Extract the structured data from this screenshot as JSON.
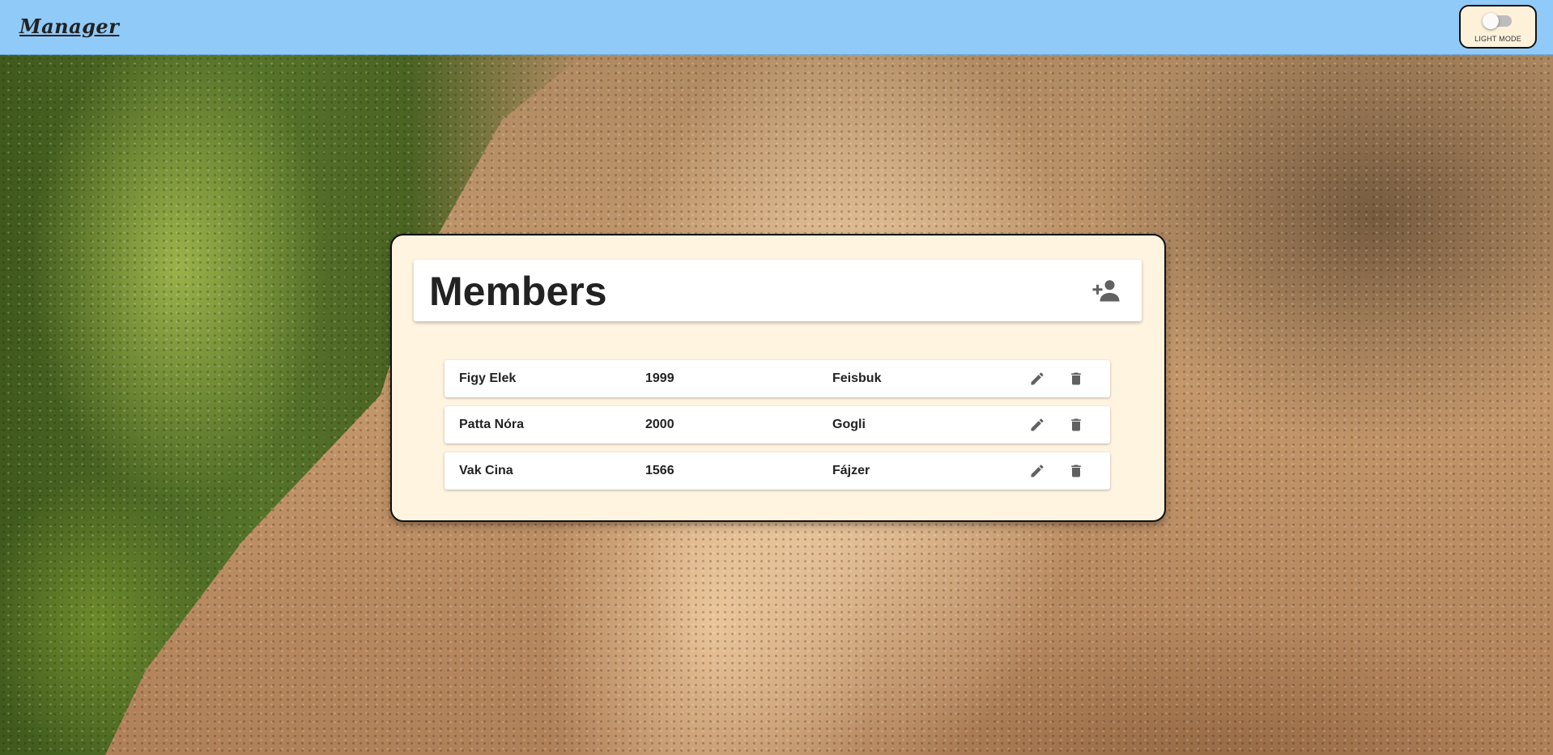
{
  "header": {
    "brand": "Manager",
    "mode_label": "LIGHT MODE"
  },
  "panel": {
    "title": "Members",
    "add_icon": "person-add-icon"
  },
  "members": [
    {
      "name": "Figy Elek",
      "year": "1999",
      "org": "Feisbuk"
    },
    {
      "name": "Patta Nóra",
      "year": "2000",
      "org": "Gogli"
    },
    {
      "name": "Vak Cina",
      "year": "1566",
      "org": "Fájzer"
    }
  ],
  "row_actions": {
    "edit_icon": "edit-icon",
    "delete_icon": "delete-icon"
  },
  "colors": {
    "header_bg": "#90caf9",
    "panel_bg": "#fff4e0",
    "icon": "#616161"
  }
}
